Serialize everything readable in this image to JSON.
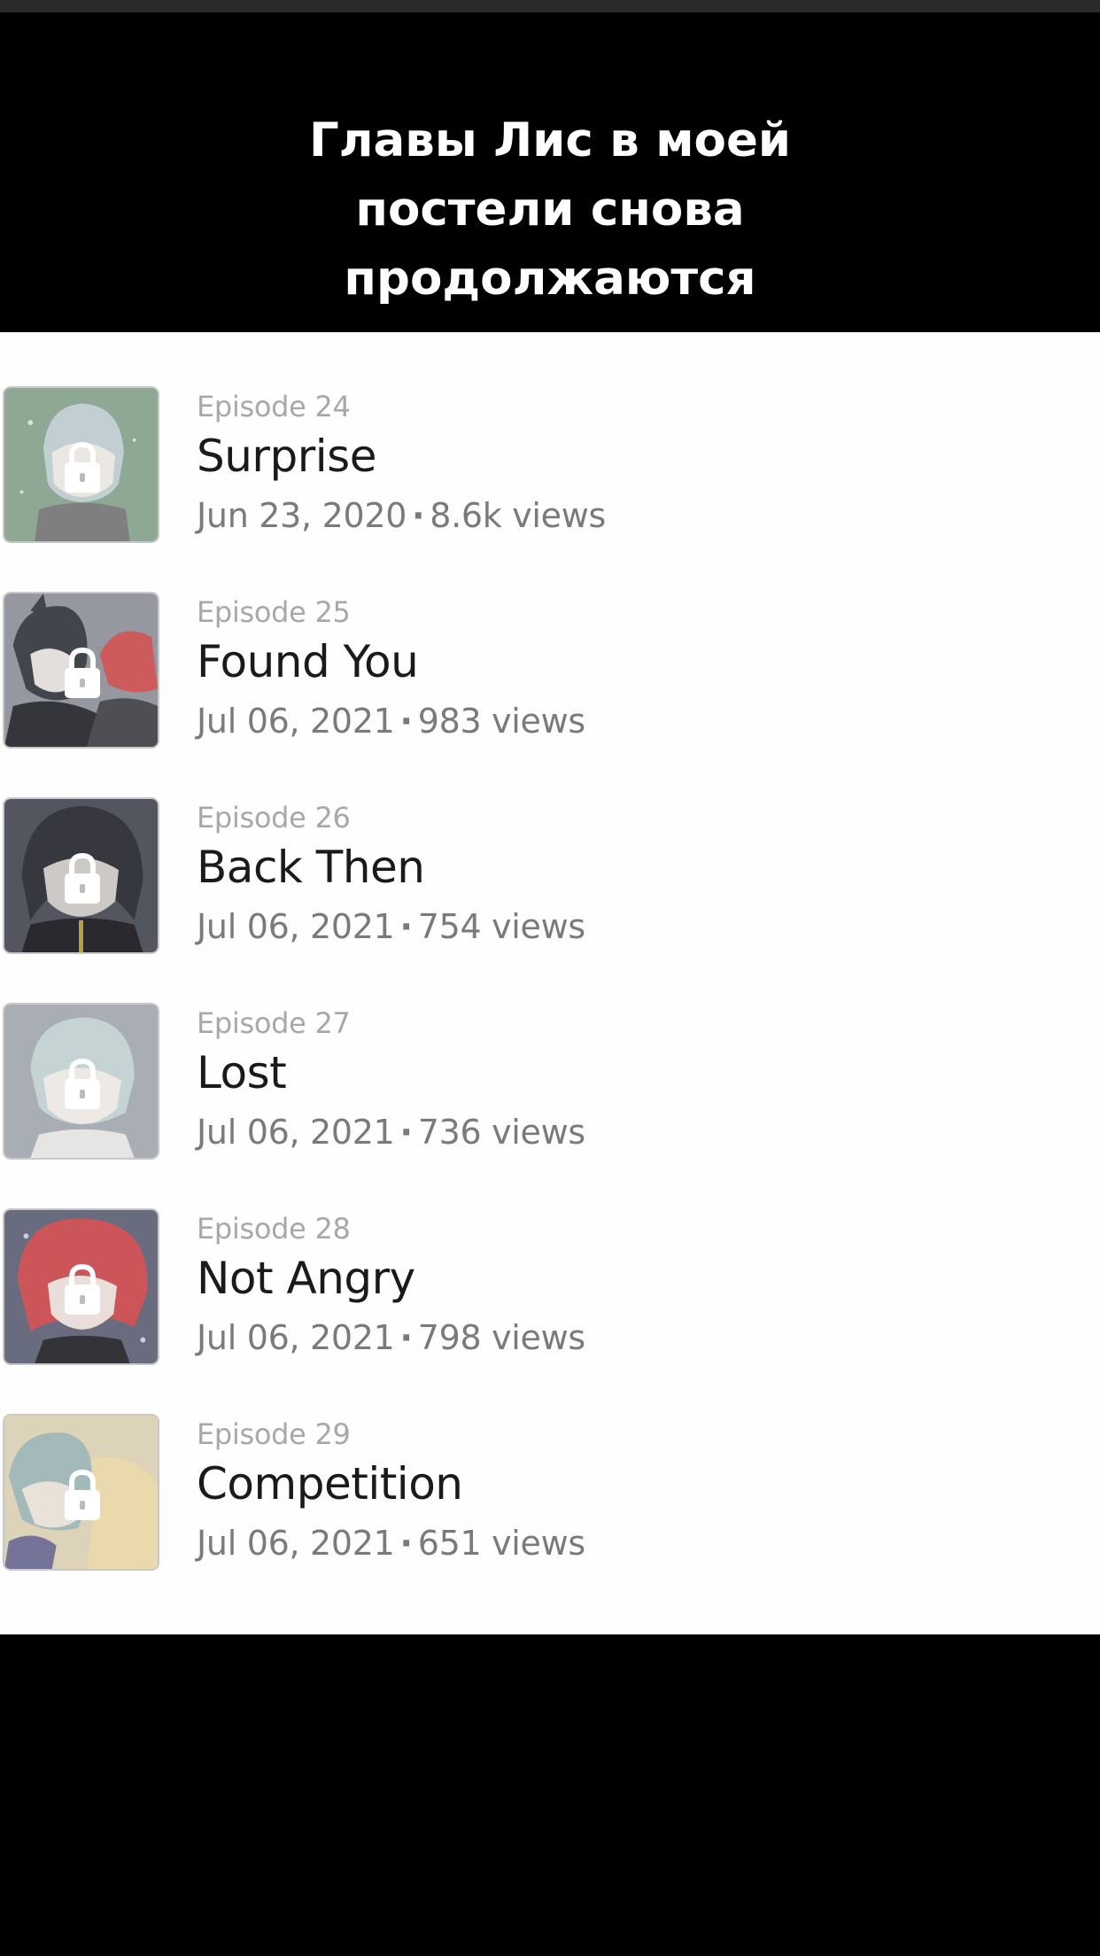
{
  "caption": {
    "lines": [
      "Главы Лис в моей",
      "постели снова",
      "продолжаются"
    ]
  },
  "colors": {
    "background": "#000000",
    "list_background": "#fefefe",
    "episode_number": "#a8a8a8",
    "title": "#1a1a1a",
    "meta": "#7a7a7a"
  },
  "episodes": [
    {
      "number": "Episode 24",
      "title": "Surprise",
      "date": "Jun 23, 2020",
      "views": "8.6k views",
      "locked": true,
      "thumb_icon": "lock-icon"
    },
    {
      "number": "Episode 25",
      "title": "Found You",
      "date": "Jul 06, 2021",
      "views": "983 views",
      "locked": true,
      "thumb_icon": "lock-icon"
    },
    {
      "number": "Episode 26",
      "title": "Back Then",
      "date": "Jul 06, 2021",
      "views": "754 views",
      "locked": true,
      "thumb_icon": "lock-icon"
    },
    {
      "number": "Episode 27",
      "title": "Lost",
      "date": "Jul 06, 2021",
      "views": "736 views",
      "locked": true,
      "thumb_icon": "lock-icon"
    },
    {
      "number": "Episode 28",
      "title": "Not Angry",
      "date": "Jul 06, 2021",
      "views": "798 views",
      "locked": true,
      "thumb_icon": "lock-icon"
    },
    {
      "number": "Episode 29",
      "title": "Competition",
      "date": "Jul 06, 2021",
      "views": "651 views",
      "locked": true,
      "thumb_icon": "lock-icon"
    }
  ],
  "meta_separator": "·"
}
